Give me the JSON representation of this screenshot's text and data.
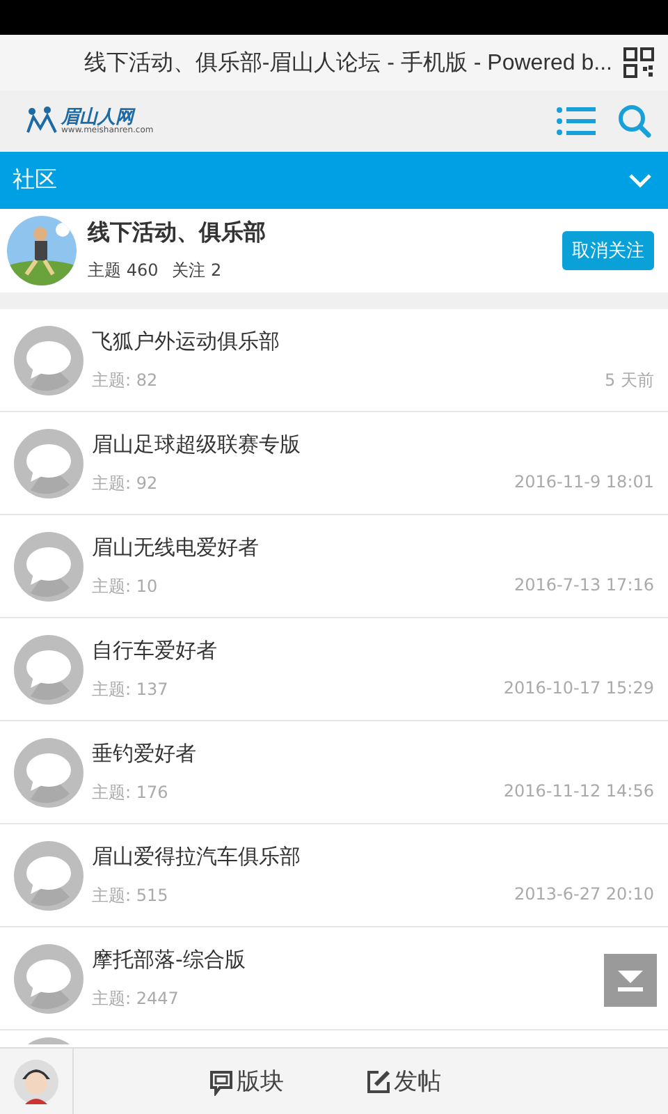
{
  "title_bar": {
    "title": "线下活动、俱乐部-眉山人论坛 - 手机版 - Powered b..."
  },
  "header": {
    "logo_name": "眉山人网",
    "logo_url": "www.meishanren.com"
  },
  "section_bar": {
    "label": "社区",
    "expanded": false
  },
  "forum": {
    "name": "线下活动、俱乐部",
    "stats": [
      {
        "label": "主题 460"
      },
      {
        "label": "关注 2"
      }
    ],
    "follow_button": "取消关注"
  },
  "boards": [
    {
      "name": "飞狐户外运动俱乐部",
      "topics": "主题: 82",
      "time": "5 天前"
    },
    {
      "name": "眉山足球超级联赛专版",
      "topics": "主题: 92",
      "time": "2016-11-9 18:01"
    },
    {
      "name": "眉山无线电爱好者",
      "topics": "主题: 10",
      "time": "2016-7-13 17:16"
    },
    {
      "name": "自行车爱好者",
      "topics": "主题: 137",
      "time": "2016-10-17 15:29"
    },
    {
      "name": "垂钓爱好者",
      "topics": "主题: 176",
      "time": "2016-11-12 14:56"
    },
    {
      "name": "眉山爱得拉汽车俱乐部",
      "topics": "主题: 515",
      "time": "2013-6-27 20:10"
    },
    {
      "name": "摩托部落-综合版",
      "topics": "主题: 2447"
    }
  ],
  "bottom_nav": [
    {
      "kind": "boards",
      "label": "版块"
    },
    {
      "kind": "post",
      "label": "发帖"
    }
  ]
}
